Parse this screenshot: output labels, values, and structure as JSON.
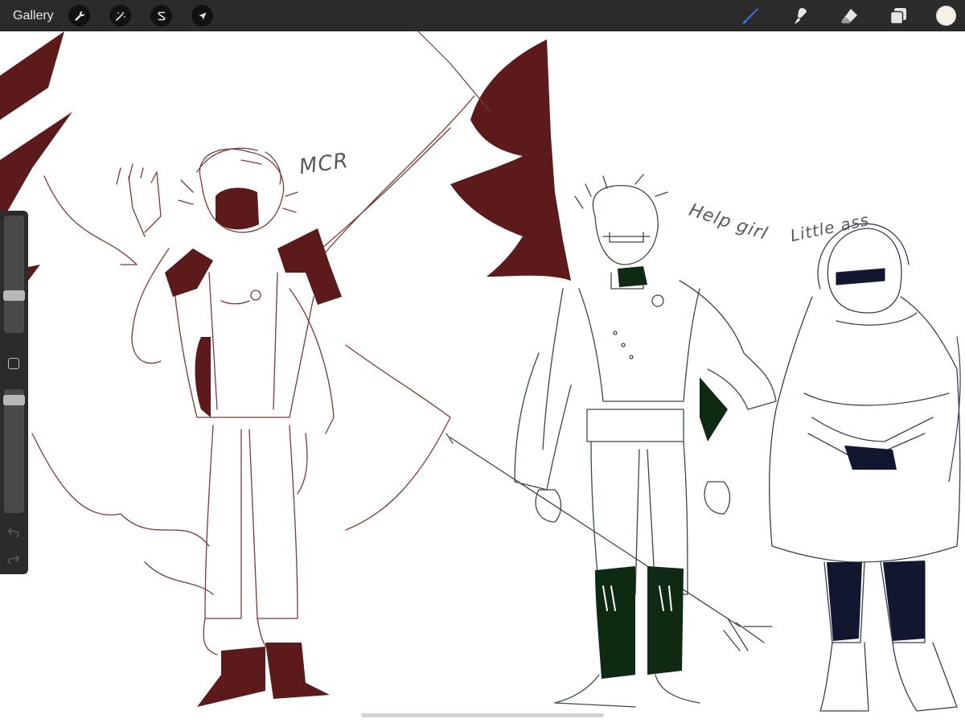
{
  "toolbar": {
    "gallery_label": "Gallery",
    "left_tools": [
      {
        "name": "actions",
        "icon": "wrench-icon"
      },
      {
        "name": "adjustments",
        "icon": "magic-wand-icon"
      },
      {
        "name": "selection",
        "icon": "selection-s-icon"
      },
      {
        "name": "transform",
        "icon": "arrow-cursor-icon"
      }
    ],
    "right_tools": [
      {
        "name": "brush",
        "icon": "brush-icon",
        "active": true
      },
      {
        "name": "smudge",
        "icon": "smudge-icon",
        "active": false
      },
      {
        "name": "eraser",
        "icon": "eraser-icon",
        "active": false
      },
      {
        "name": "layers",
        "icon": "layers-icon",
        "active": false
      }
    ],
    "current_color": "#f6f1e4"
  },
  "canvas": {
    "labels": {
      "mcr": "MCR",
      "help_girl": "Help girl",
      "little_ass": "Little ass"
    },
    "colors": {
      "red_fill": "#5c1a1a",
      "red_line": "#6b2a2a",
      "green_fill": "#0e2a12",
      "green_line": "#2f3d2f",
      "navy_fill": "#12162e",
      "navy_line": "#3a3d55"
    }
  },
  "sidebar": {
    "brush_size": 0.3,
    "opacity": 0.95,
    "modify_icon": "square-icon",
    "undo_icon": "undo-icon",
    "redo_icon": "redo-icon"
  },
  "accent_color": "#2f7cf6"
}
